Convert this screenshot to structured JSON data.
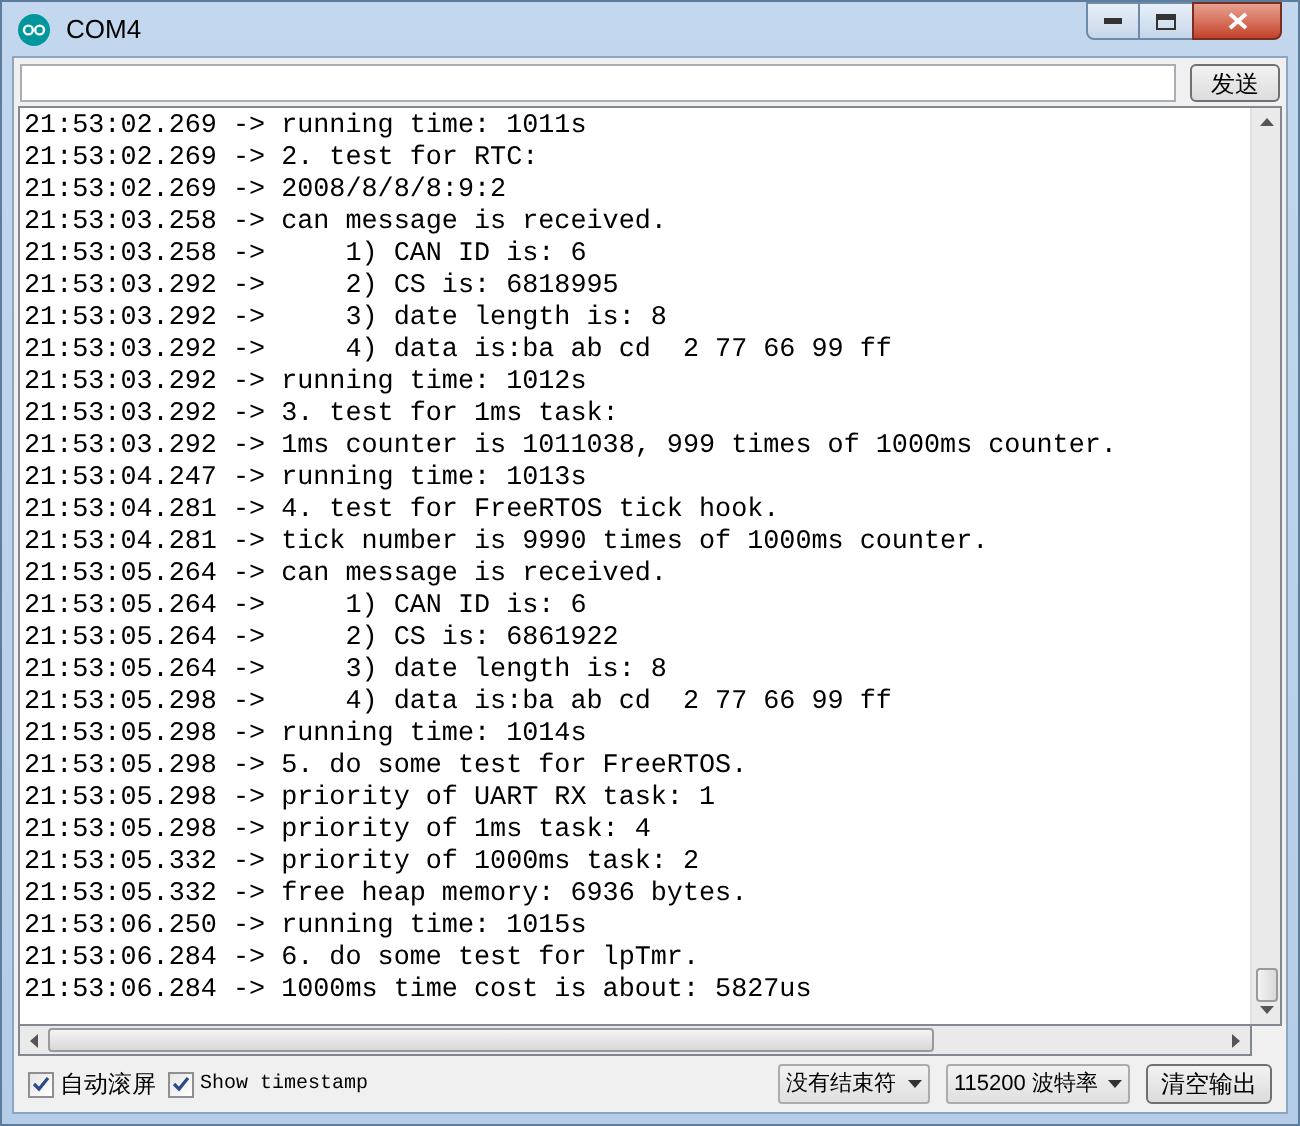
{
  "window": {
    "title": "COM4"
  },
  "send_button": "发送",
  "log_lines": [
    "21:53:02.269 -> running time: 1011s",
    "21:53:02.269 -> 2. test for RTC:",
    "21:53:02.269 -> 2008/8/8/8:9:2",
    "21:53:03.258 -> can message is received.",
    "21:53:03.258 ->     1) CAN ID is: 6",
    "21:53:03.292 ->     2) CS is: 6818995",
    "21:53:03.292 ->     3) date length is: 8",
    "21:53:03.292 ->     4) data is:ba ab cd  2 77 66 99 ff",
    "21:53:03.292 -> running time: 1012s",
    "21:53:03.292 -> 3. test for 1ms task:",
    "21:53:03.292 -> 1ms counter is 1011038, 999 times of 1000ms counter.",
    "21:53:04.247 -> running time: 1013s",
    "21:53:04.281 -> 4. test for FreeRTOS tick hook.",
    "21:53:04.281 -> tick number is 9990 times of 1000ms counter.",
    "21:53:05.264 -> can message is received.",
    "21:53:05.264 ->     1) CAN ID is: 6",
    "21:53:05.264 ->     2) CS is: 6861922",
    "21:53:05.264 ->     3) date length is: 8",
    "21:53:05.298 ->     4) data is:ba ab cd  2 77 66 99 ff",
    "21:53:05.298 -> running time: 1014s",
    "21:53:05.298 -> 5. do some test for FreeRTOS.",
    "21:53:05.298 -> priority of UART RX task: 1",
    "21:53:05.298 -> priority of 1ms task: 4",
    "21:53:05.332 -> priority of 1000ms task: 2",
    "21:53:05.332 -> free heap memory: 6936 bytes.",
    "21:53:06.250 -> running time: 1015s",
    "21:53:06.284 -> 6. do some test for lpTmr.",
    "21:53:06.284 -> 1000ms time cost is about: 5827us"
  ],
  "footer": {
    "checkboxes": [
      {
        "label": "自动滚屏",
        "checked": true,
        "kind": "cjk"
      },
      {
        "label": "Show timestamp",
        "checked": true,
        "kind": "mono"
      }
    ],
    "line_ending": "没有结束符",
    "baud_rate": "115200 波特率",
    "clear_button": "清空输出"
  }
}
